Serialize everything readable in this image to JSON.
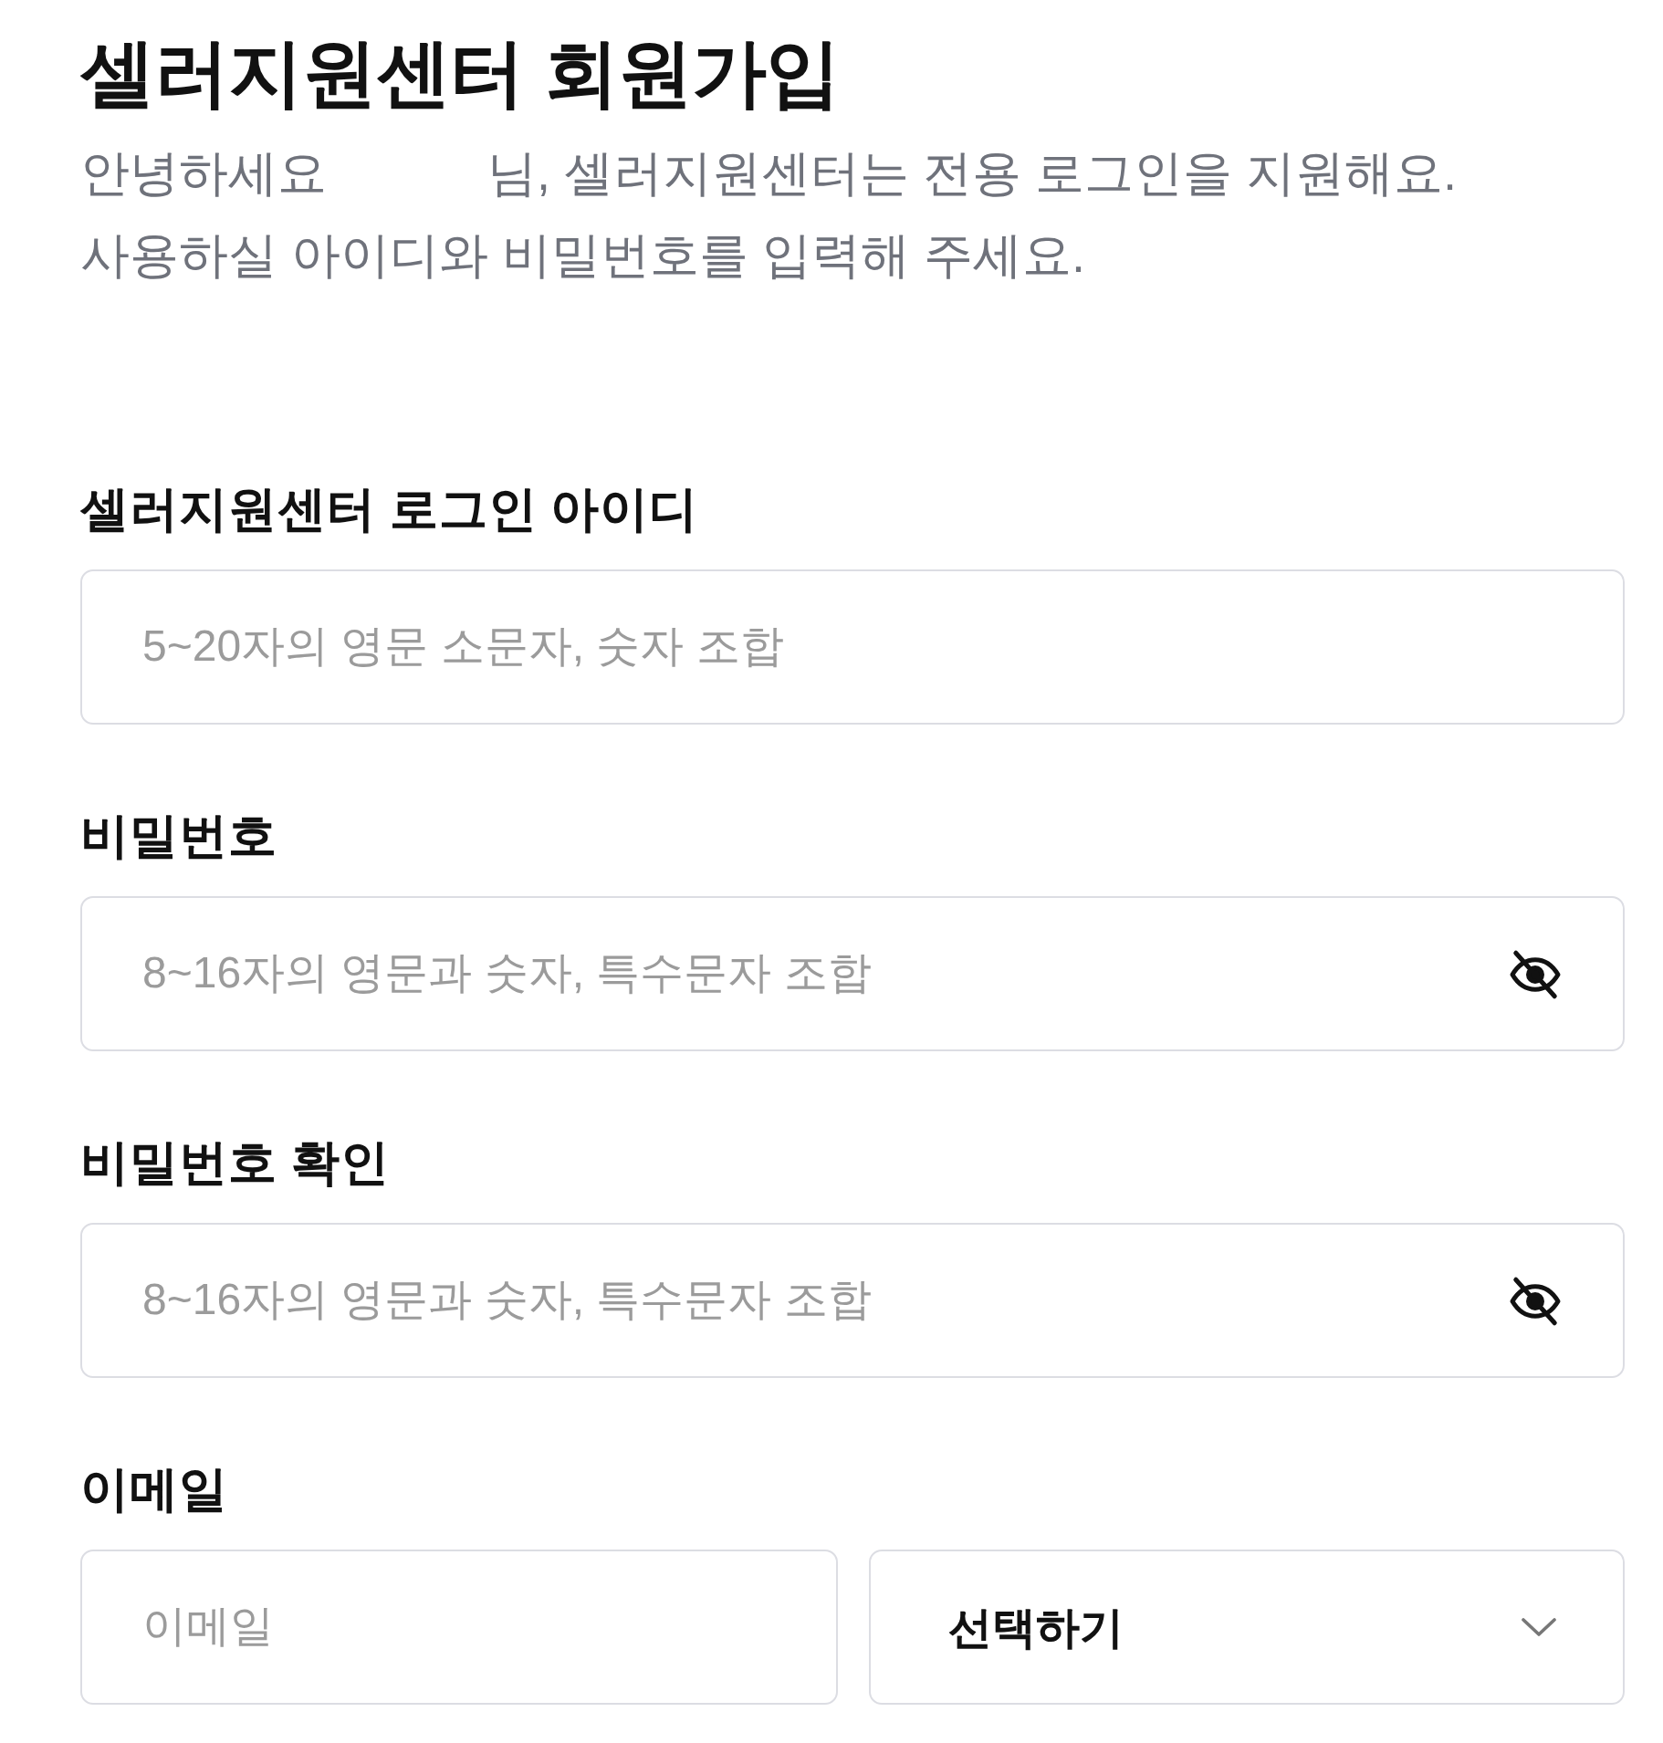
{
  "title": "셀러지원센터 회원가입",
  "intro": {
    "greeting": "안녕하세요",
    "greeting_rest": "님, 셀러지원센터는 전용 로그인을 지원해요.",
    "line_2": "사용하실 아이디와 비밀번호를 입력해 주세요."
  },
  "fields": [
    {
      "kind": "text",
      "label": "셀러지원센터 로그인 아이디",
      "placeholder": "5~20자의 영문 소문자, 숫자 조합"
    },
    {
      "kind": "password",
      "label": "비밀번호",
      "placeholder": "8~16자의 영문과 숫자, 특수문자 조합",
      "revealed": false
    },
    {
      "kind": "password",
      "label": "비밀번호 확인",
      "placeholder": "8~16자의 영문과 숫자, 특수문자 조합",
      "revealed": false
    },
    {
      "kind": "email",
      "label": "이메일",
      "placeholder": "이메일",
      "domain_select": {
        "value": "선택하기"
      }
    }
  ]
}
